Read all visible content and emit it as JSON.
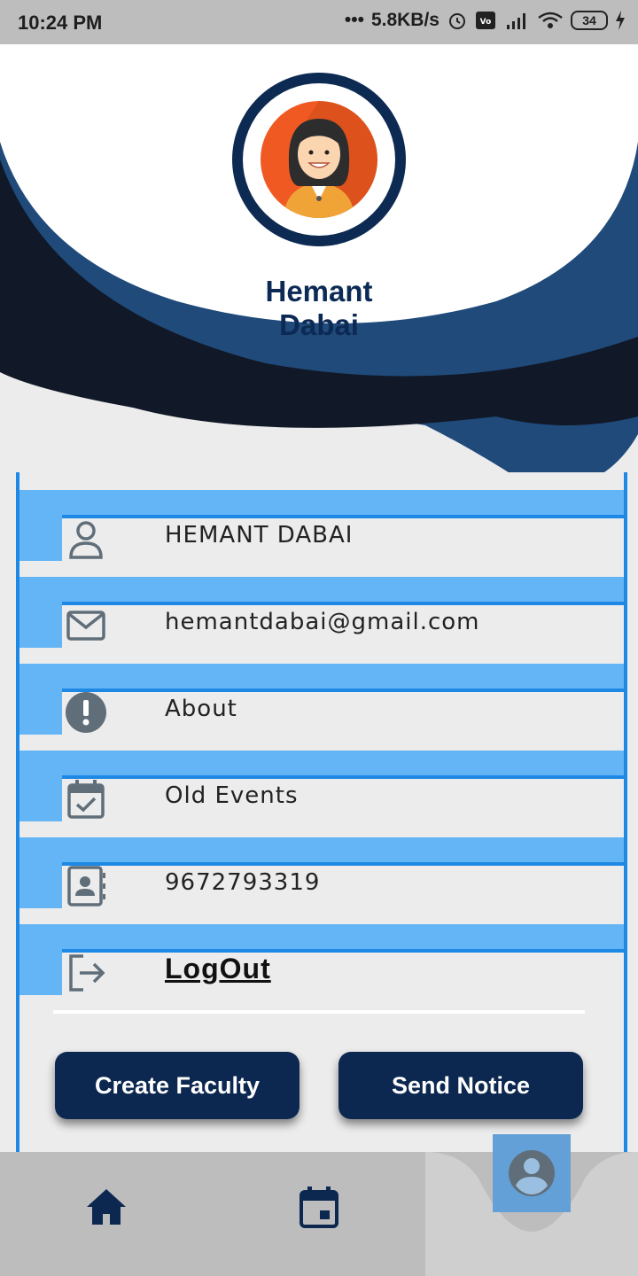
{
  "status_bar": {
    "time": "10:24 PM",
    "network_speed": "5.8KB/s",
    "battery_level": "34"
  },
  "profile": {
    "name": "Hemant Dabai"
  },
  "menu": {
    "items": [
      {
        "label": "HEMANT DABAI",
        "icon": "person-icon"
      },
      {
        "label": "hemantdabai@gmail.com",
        "icon": "mail-icon"
      },
      {
        "label": "About",
        "icon": "info-alert-icon"
      },
      {
        "label": "Old Events",
        "icon": "calendar-check-icon"
      },
      {
        "label": "9672793319",
        "icon": "contact-card-icon"
      },
      {
        "label": "LogOut",
        "icon": "logout-icon"
      }
    ]
  },
  "actions": {
    "create_faculty": "Create Faculty",
    "send_notice": "Send Notice"
  },
  "bottom_nav": {
    "items": [
      "home-icon",
      "calendar-icon",
      "account-circle-icon"
    ],
    "active": "account-circle-icon"
  },
  "colors": {
    "navy": "#0c2850",
    "accent_blue": "#1e88e5",
    "light_blue": "#64b5f6",
    "avatar_orange": "#f05a22"
  }
}
